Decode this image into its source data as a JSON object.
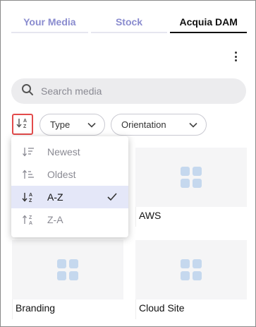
{
  "tabs": [
    {
      "label": "Your Media",
      "active": false
    },
    {
      "label": "Stock",
      "active": false
    },
    {
      "label": "Acquia DAM",
      "active": true
    }
  ],
  "search": {
    "placeholder": "Search media",
    "value": ""
  },
  "filters": {
    "type_label": "Type",
    "orientation_label": "Orientation"
  },
  "sort_menu": {
    "items": [
      {
        "label": "Newest",
        "icon": "sort-newest-icon",
        "selected": false
      },
      {
        "label": "Oldest",
        "icon": "sort-oldest-icon",
        "selected": false
      },
      {
        "label": "A-Z",
        "icon": "sort-az-icon",
        "selected": true
      },
      {
        "label": "Z-A",
        "icon": "sort-za-icon",
        "selected": false
      }
    ]
  },
  "tiles": [
    {
      "label": ""
    },
    {
      "label": "AWS"
    },
    {
      "label": "Branding"
    },
    {
      "label": "Cloud Site"
    }
  ],
  "colors": {
    "accent_active_tab": "#111111",
    "inactive_tab": "#8a8ccf",
    "sort_button_border": "#e34b4b",
    "selected_item_bg": "#e4e7f8",
    "placeholder_icon": "#c5d8ee"
  }
}
